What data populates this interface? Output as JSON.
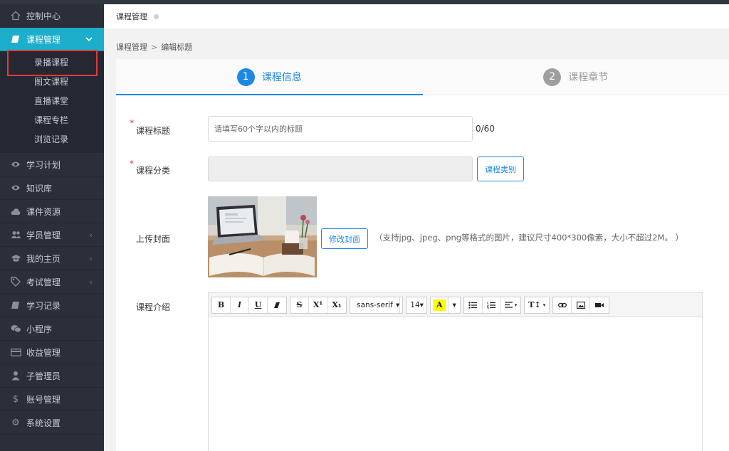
{
  "sidebar": {
    "items": [
      {
        "label": "控制中心",
        "icon": "home-icon"
      },
      {
        "label": "课程管理",
        "icon": "book-icon",
        "active": true,
        "arrow": "⌄"
      },
      {
        "label": "学习计划",
        "icon": "eye-icon"
      },
      {
        "label": "知识库",
        "icon": "eye-icon"
      },
      {
        "label": "课件资源",
        "icon": "cloud-icon"
      },
      {
        "label": "学员管理",
        "icon": "users-icon",
        "arrow": "‹"
      },
      {
        "label": "我的主页",
        "icon": "graduation-cap-icon",
        "arrow": "‹"
      },
      {
        "label": "考试管理",
        "icon": "tag-icon",
        "arrow": "‹"
      },
      {
        "label": "学习记录",
        "icon": "book-icon"
      },
      {
        "label": "小程序",
        "icon": "wechat-icon"
      },
      {
        "label": "收益管理",
        "icon": "credit-card-icon"
      },
      {
        "label": "子管理员",
        "icon": "user-icon"
      },
      {
        "label": "账号管理",
        "icon": "dollar-icon"
      },
      {
        "label": "系统设置",
        "icon": "gear-icon"
      }
    ],
    "sub_items": [
      "录播课程",
      "图文课程",
      "直播课堂",
      "课程专栏",
      "浏览记录"
    ]
  },
  "tabbar": {
    "title": "课程管理"
  },
  "breadcrumb": {
    "parent": "课程管理",
    "separator": ">",
    "current": "编辑标题"
  },
  "steps": [
    {
      "num": "1",
      "label": "课程信息"
    },
    {
      "num": "2",
      "label": "课程章节"
    }
  ],
  "form": {
    "required_mark": "*",
    "title_label": "课程标题",
    "title_placeholder": "请填写60个字以内的标题",
    "title_counter": "0/60",
    "category_label": "课程分类",
    "category_button": "课程类别",
    "cover_label": "上传封面",
    "cover_button": "修改封面",
    "cover_hint": "（支持jpg、jpeg、png等格式的图片，建议尺寸400*300像素，大小不超过2M。 ）",
    "intro_label": "课程介绍"
  },
  "editor_toolbar": {
    "bold": "B",
    "italic": "I",
    "underline": "U",
    "eraser": "⌫",
    "strike": "S",
    "superscript": "X¹",
    "subscript": "X₁",
    "font_family": "sans-serif",
    "font_size": "14",
    "text_color": "A",
    "line_height": "T↕",
    "caret": "▾"
  },
  "colors": {
    "accent": "#1e88e5",
    "sidebar_bg": "#2b2f3a",
    "sidebar_active": "#1caeca",
    "highlight_border": "#e23a3a"
  }
}
